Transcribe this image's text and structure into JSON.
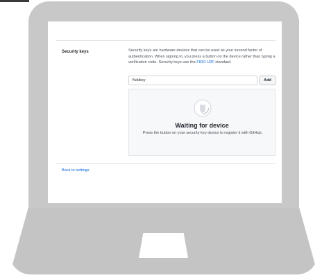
{
  "security_keys": {
    "title": "Security keys",
    "description": "Security keys are hardware devices that can be used as your second factor of authentication. When signing in, you press a button on the device rather than typing a verification code. Security keys use the ",
    "standard_link": "FIDO U2F",
    "description_end": " standard.",
    "key_name_value": "Yubikey",
    "add_label": "Add"
  },
  "waiting": {
    "title": "Waiting for device",
    "text": "Press the button on your security key device to register it with GitHub.",
    "icon": "security-key-icon"
  },
  "back_link": "Back to settings",
  "colors": {
    "link": "#0366d6",
    "laptop": "#c8c8c8"
  }
}
